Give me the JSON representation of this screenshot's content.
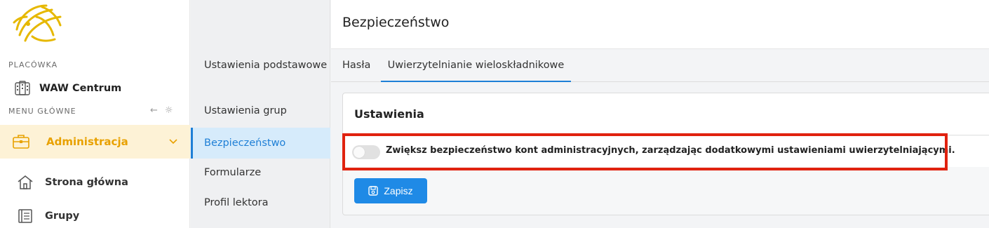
{
  "sidebar": {
    "placowka_label": "PLACÓWKA",
    "location_name": "WAW Centrum",
    "menu_label": "MENU GŁÓWNE",
    "admin_label": "Administracja",
    "items": [
      {
        "label": "Strona główna",
        "icon": "home-icon"
      },
      {
        "label": "Grupy",
        "icon": "book-icon"
      }
    ]
  },
  "subnav": {
    "items": [
      {
        "label": "Ustawienia podstawowe"
      },
      {
        "label": "Ustawienia grup"
      },
      {
        "label": "Bezpieczeństwo"
      },
      {
        "label": "Formularze"
      },
      {
        "label": "Profil lektora"
      }
    ]
  },
  "main": {
    "title": "Bezpieczeństwo",
    "tabs": [
      {
        "label": "Hasła"
      },
      {
        "label": "Uwierzytelnianie wieloskładnikowe"
      }
    ],
    "card": {
      "title": "Ustawienia",
      "toggle_label": "Zwiększ bezpieczeństwo kont administracyjnych, zarządzając dodatkowymi ustawieniami uwierzytelniającymi.",
      "save_label": "Zapisz"
    }
  },
  "colors": {
    "accent": "#1e7fd6",
    "admin_text": "#e8a100",
    "admin_bg": "#fdf2d6",
    "highlight": "#e0220f"
  }
}
